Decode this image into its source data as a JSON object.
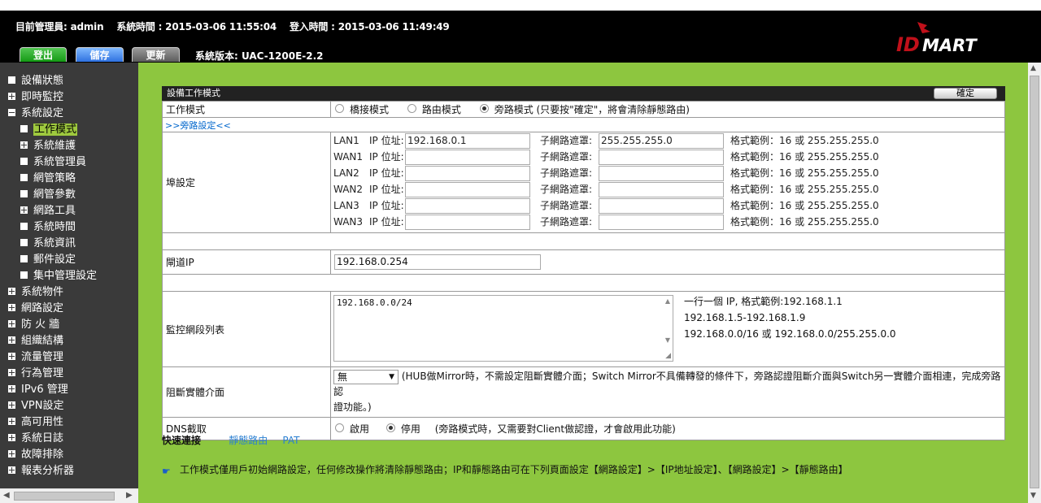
{
  "header": {
    "admin": "目前管理員: admin",
    "sys_time": "系統時間 : 2015-03-06 11:55:04",
    "login_time": "登入時間 : 2015-03-06 11:49:49",
    "buttons": {
      "logout": "登出",
      "save": "儲存",
      "update": "更新"
    },
    "fw_version": "系統版本: UAC-1200E-2.2",
    "logo": "IDMART"
  },
  "sidebar": [
    {
      "label": "設備狀態",
      "icon": "square",
      "level": 0
    },
    {
      "label": "即時監控",
      "icon": "plus",
      "level": 0
    },
    {
      "label": "系統設定",
      "icon": "minus",
      "level": 0
    },
    {
      "label": "工作模式",
      "icon": "square",
      "level": 1,
      "active": true
    },
    {
      "label": "系統維護",
      "icon": "plus",
      "level": 1
    },
    {
      "label": "系統管理員",
      "icon": "square",
      "level": 1
    },
    {
      "label": "網管策略",
      "icon": "square",
      "level": 1
    },
    {
      "label": "網管參數",
      "icon": "square",
      "level": 1
    },
    {
      "label": "網路工具",
      "icon": "plus",
      "level": 1
    },
    {
      "label": "系統時間",
      "icon": "square",
      "level": 1
    },
    {
      "label": "系統資訊",
      "icon": "square",
      "level": 1
    },
    {
      "label": "郵件設定",
      "icon": "square",
      "level": 1
    },
    {
      "label": "集中管理設定",
      "icon": "square",
      "level": 1
    },
    {
      "label": "系統物件",
      "icon": "plus",
      "level": 0
    },
    {
      "label": "網路設定",
      "icon": "plus",
      "level": 0
    },
    {
      "label": "防 火 牆",
      "icon": "plus",
      "level": 0
    },
    {
      "label": "組織結構",
      "icon": "plus",
      "level": 0
    },
    {
      "label": "流量管理",
      "icon": "plus",
      "level": 0
    },
    {
      "label": "行為管理",
      "icon": "plus",
      "level": 0
    },
    {
      "label": "IPv6 管理",
      "icon": "plus",
      "level": 0
    },
    {
      "label": "VPN設定",
      "icon": "plus",
      "level": 0
    },
    {
      "label": "高可用性",
      "icon": "plus",
      "level": 0
    },
    {
      "label": "系統日誌",
      "icon": "plus",
      "level": 0
    },
    {
      "label": "故障排除",
      "icon": "plus",
      "level": 0
    },
    {
      "label": "報表分析器",
      "icon": "plus",
      "level": 0
    }
  ],
  "panel": {
    "title": "設備工作模式",
    "confirm": "確定",
    "work_mode_label": "工作模式",
    "modes": [
      "橋接模式",
      "路由模式",
      "旁路模式 (只要按\"確定\"，將會清除靜態路由)"
    ],
    "selected_mode": 2,
    "bypass_link": ">>旁路設定<<",
    "port_label": "埠設定",
    "ip_label": "IP 位址:",
    "mask_label": "子網路遮罩:",
    "format_hint": "格式範例：16 或 255.255.255.0",
    "ports": [
      {
        "name": "LAN1",
        "ip": "192.168.0.1",
        "mask": "255.255.255.0"
      },
      {
        "name": "WAN1",
        "ip": "",
        "mask": ""
      },
      {
        "name": "LAN2",
        "ip": "",
        "mask": ""
      },
      {
        "name": "WAN2",
        "ip": "",
        "mask": ""
      },
      {
        "name": "LAN3",
        "ip": "",
        "mask": ""
      },
      {
        "name": "WAN3",
        "ip": "",
        "mask": ""
      }
    ],
    "gateway_label": "閘道IP",
    "gateway_value": "192.168.0.254",
    "monitor_label": "監控網段列表",
    "monitor_value": "192.168.0.0/24",
    "monitor_hint": [
      "一行一個 IP, 格式範例:192.168.1.1",
      "192.168.1.5-192.168.1.9",
      "192.168.0.0/16 或 192.168.0.0/255.255.0.0"
    ],
    "block_label": "阻斷實體介面",
    "block_value": "無",
    "block_hint": "(HUB做Mirror時，不需設定阻斷實體介面；Switch Mirror不具備轉發的條件下，旁路認證阻斷介面與Switch另一實體介面相連，完成旁路認",
    "block_hint2": "證功能。)",
    "dns_label": "DNS截取",
    "dns_options": [
      "啟用",
      "停用"
    ],
    "dns_selected": 1,
    "dns_hint": "(旁路模式時，又需要對Client做認證，才會啟用此功能)"
  },
  "quick": {
    "label": "快速連接",
    "links": [
      "靜態路由",
      "PAT"
    ]
  },
  "note": "工作模式僅用戶初始網路設定，任何修改操作將清除靜態路由；IP和靜態路由可在下列頁面設定【網路設定】>【IP地址設定】、【網路設定】>【靜態路由】"
}
